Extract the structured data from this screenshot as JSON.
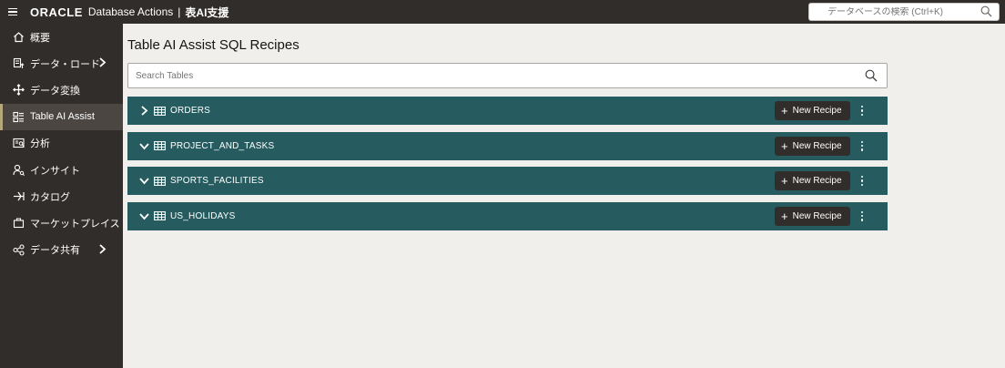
{
  "header": {
    "brand": "ORACLE",
    "app_name": "Database Actions",
    "separator": "|",
    "page_name": "表AI支援",
    "search_placeholder": "データベースの検索 (Ctrl+K)"
  },
  "sidebar": {
    "items": [
      {
        "label": "概要",
        "icon": "home-icon",
        "active": false,
        "has_chevron": false
      },
      {
        "label": "データ・ロード",
        "icon": "data-load-icon",
        "active": false,
        "has_chevron": true
      },
      {
        "label": "データ変換",
        "icon": "transform-icon",
        "active": false,
        "has_chevron": false
      },
      {
        "label": "Table AI Assist",
        "icon": "table-ai-icon",
        "active": true,
        "has_chevron": false
      },
      {
        "label": "分析",
        "icon": "analysis-icon",
        "active": false,
        "has_chevron": false
      },
      {
        "label": "インサイト",
        "icon": "insight-icon",
        "active": false,
        "has_chevron": false
      },
      {
        "label": "カタログ",
        "icon": "catalog-icon",
        "active": false,
        "has_chevron": false
      },
      {
        "label": "マーケットプレイス",
        "icon": "marketplace-icon",
        "active": false,
        "has_chevron": false
      },
      {
        "label": "データ共有",
        "icon": "data-share-icon",
        "active": false,
        "has_chevron": true
      }
    ]
  },
  "main": {
    "title": "Table AI Assist SQL Recipes",
    "search_placeholder": "Search Tables",
    "new_recipe_label": "New Recipe",
    "tables": [
      {
        "name": "ORDERS",
        "expanded": false
      },
      {
        "name": "PROJECT_AND_TASKS",
        "expanded": true
      },
      {
        "name": "SPORTS_FACILITIES",
        "expanded": true
      },
      {
        "name": "US_HOLIDAYS",
        "expanded": true
      }
    ]
  },
  "colors": {
    "topbar": "#312d2a",
    "sidebar": "#312d2a",
    "row": "#265c5f",
    "button": "#312d2a",
    "background": "#f1efec"
  }
}
